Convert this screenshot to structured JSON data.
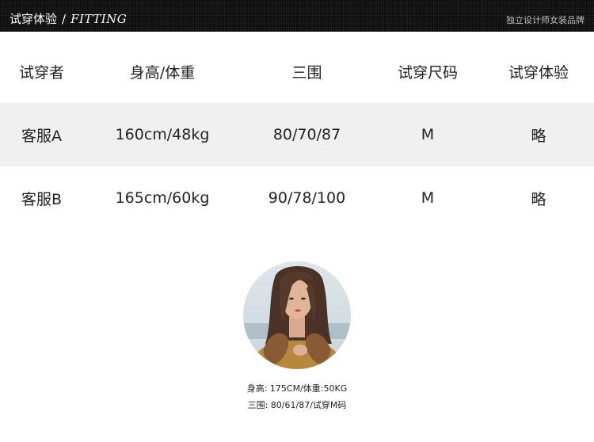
{
  "header": {
    "title_cn": "试穿体验",
    "separator": "/",
    "title_en": "FITTING",
    "brand": "独立设计师女装品牌"
  },
  "table": {
    "columns": [
      "试穿者",
      "身高/体重",
      "三围",
      "试穿尺码",
      "试穿体验"
    ],
    "rows": [
      [
        "客服A",
        "160cm/48kg",
        "80/70/87",
        "M",
        "略"
      ],
      [
        "客服B",
        "165cm/60kg",
        "90/78/100",
        "M",
        "略"
      ]
    ]
  },
  "model": {
    "line1": "身高: 175CM/体重:50KG",
    "line2": "三围: 80/61/87/试穿M码"
  }
}
